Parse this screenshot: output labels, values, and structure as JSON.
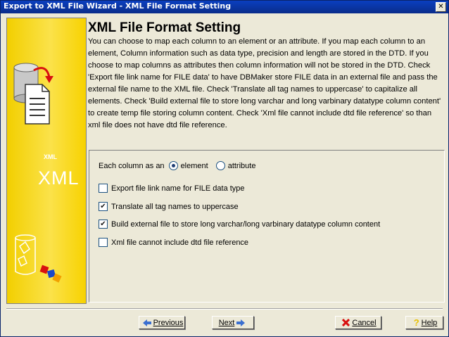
{
  "window": {
    "title": "Export to XML File Wizard - XML File Format Setting",
    "close_glyph": "✕"
  },
  "sidebar": {
    "logo_large": "XML",
    "logo_small": "XML"
  },
  "main": {
    "heading": "XML File Format Setting",
    "description": "You can choose to map each column to an element or an attribute. If you map each column to an element, Column information such as data type, precision and length are stored in the DTD. If you choose to map columns as attributes then column information will not be stored in the DTD. Check 'Export file link name for FILE data' to have DBMaker store FILE data in an external file and pass the external file name to the XML file. Check 'Translate all tag names to uppercase' to capitalize all elements. Check 'Build external file to store long varchar and long varbinary datatype column content' to create temp file storing column content. Check 'Xml file cannot include dtd file reference' so than xml file does not have dtd file reference."
  },
  "options": {
    "column_as_label": "Each column as an",
    "radios": [
      {
        "label": "element",
        "selected": true
      },
      {
        "label": "attribute",
        "selected": false
      }
    ],
    "checkboxes": [
      {
        "label": "Export file link name for FILE data type",
        "checked": false
      },
      {
        "label": "Translate all tag names to uppercase",
        "checked": true
      },
      {
        "label": "Build external file to store long varchar/long varbinary datatype column content",
        "checked": true
      },
      {
        "label": "Xml file cannot include dtd file reference",
        "checked": false
      }
    ],
    "check_glyph": "✔"
  },
  "buttons": {
    "previous": {
      "label": "Previous",
      "icon": "left-arrow-icon"
    },
    "next": {
      "label": "Next",
      "icon": "right-arrow-icon"
    },
    "cancel": {
      "label": "Cancel",
      "icon": "red-x-icon"
    },
    "help": {
      "label": "Help",
      "icon": "question-mark-icon"
    }
  },
  "colors": {
    "titlebar": "#0a3fbf",
    "sidebar": "#f7d200",
    "background": "#ece9d8",
    "arrow": "#3a6fd0",
    "cancel_x": "#d81010",
    "help_q": "#e8c000"
  }
}
